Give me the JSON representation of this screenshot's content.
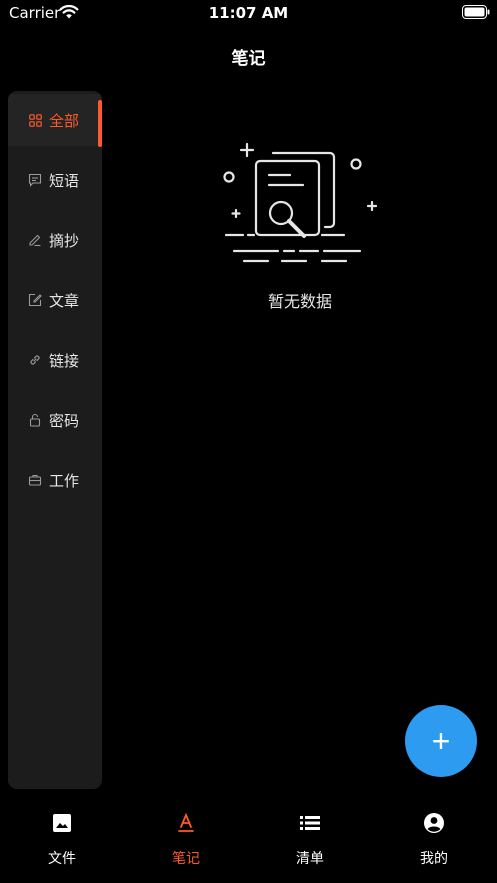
{
  "status_bar": {
    "carrier": "Carrier",
    "time": "11:07 AM"
  },
  "nav": {
    "title": "笔记"
  },
  "sidebar": {
    "items": [
      {
        "label": "全部",
        "icon": "grid-icon",
        "active": true
      },
      {
        "label": "短语",
        "icon": "message-icon",
        "active": false
      },
      {
        "label": "摘抄",
        "icon": "pencil-icon",
        "active": false
      },
      {
        "label": "文章",
        "icon": "edit-icon",
        "active": false
      },
      {
        "label": "链接",
        "icon": "link-icon",
        "active": false
      },
      {
        "label": "密码",
        "icon": "lock-icon",
        "active": false
      },
      {
        "label": "工作",
        "icon": "briefcase-icon",
        "active": false
      }
    ]
  },
  "empty_state": {
    "text": "暂无数据",
    "icon": "document-search-icon"
  },
  "fab": {
    "label": "+",
    "icon": "plus-icon"
  },
  "tab_bar": {
    "tabs": [
      {
        "label": "文件",
        "icon": "image-icon",
        "active": false
      },
      {
        "label": "笔记",
        "icon": "text-format-icon",
        "active": true
      },
      {
        "label": "清单",
        "icon": "list-icon",
        "active": false
      },
      {
        "label": "我的",
        "icon": "account-icon",
        "active": false
      }
    ]
  },
  "colors": {
    "background": "#000000",
    "sidebar": "#1c1c1c",
    "accent": "#ff5a2e",
    "fab": "#2d9bf0"
  }
}
